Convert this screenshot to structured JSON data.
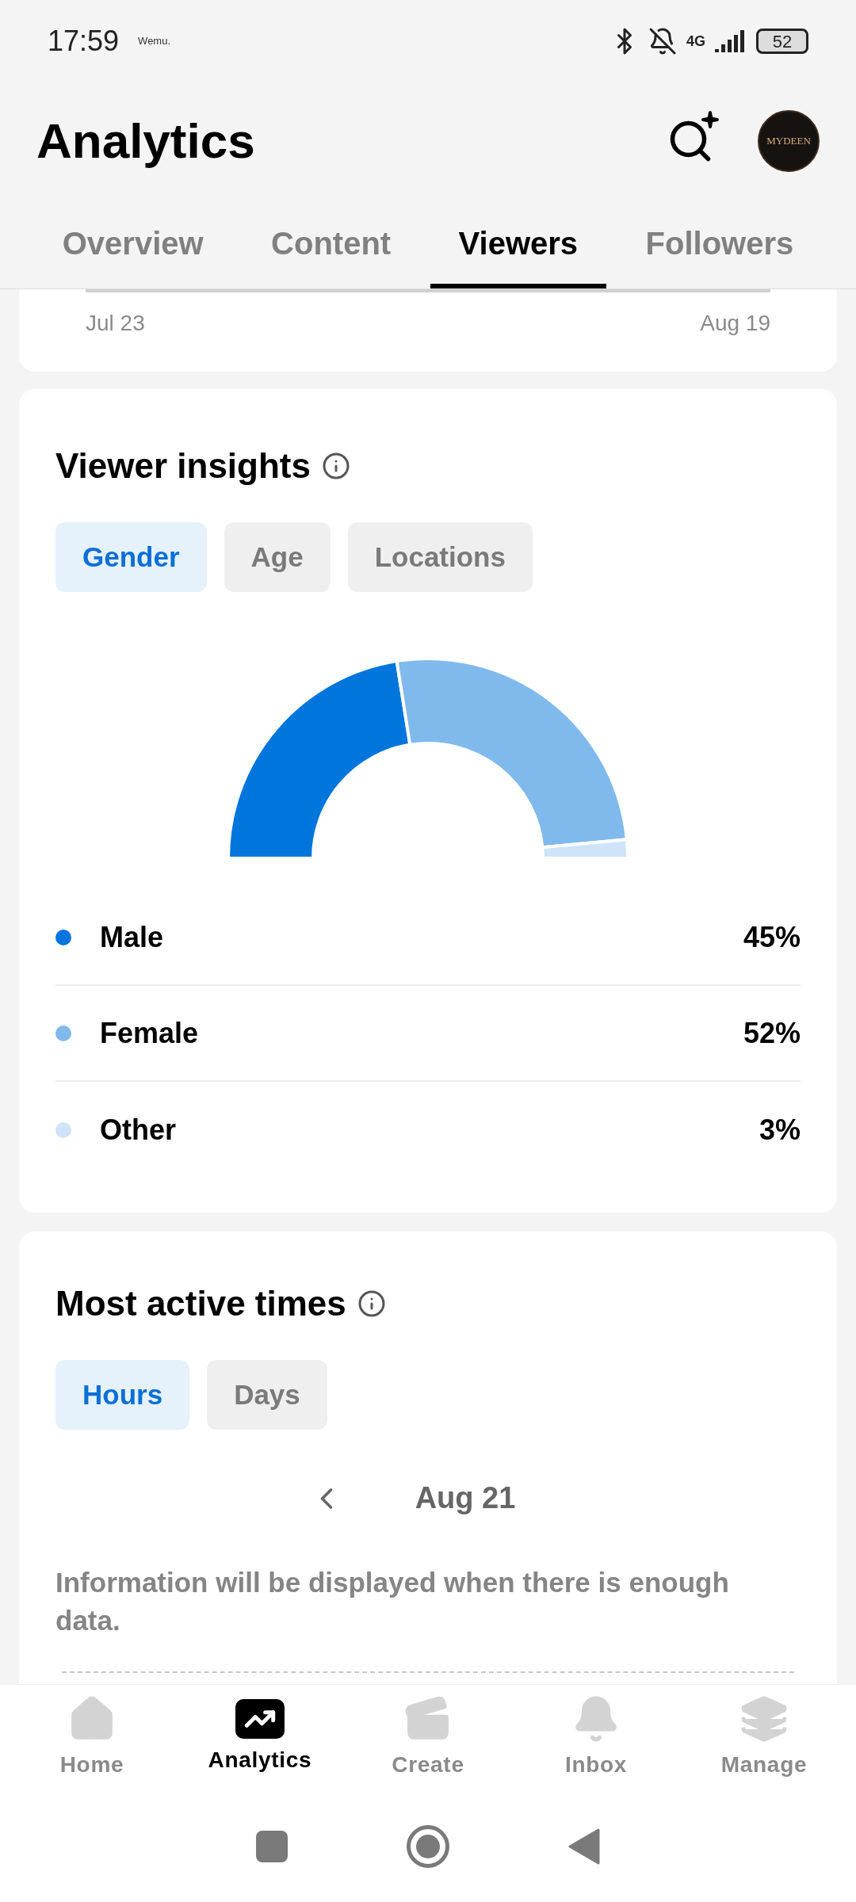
{
  "status_bar": {
    "time": "17:59",
    "carrier_logo": "Wemu.",
    "network": "4G",
    "battery": "52"
  },
  "header": {
    "title": "Analytics",
    "avatar_text": "MYDEEN"
  },
  "tabs": [
    {
      "label": "Overview",
      "selected": false
    },
    {
      "label": "Content",
      "selected": false
    },
    {
      "label": "Viewers",
      "selected": true
    },
    {
      "label": "Followers",
      "selected": false
    }
  ],
  "previous_card": {
    "start_date": "Jul 23",
    "end_date": "Aug 19"
  },
  "viewer_insights": {
    "title": "Viewer insights",
    "filters": [
      {
        "label": "Gender",
        "selected": true
      },
      {
        "label": "Age",
        "selected": false
      },
      {
        "label": "Locations",
        "selected": false
      }
    ],
    "chart_data": {
      "type": "donut",
      "categories": [
        "Male",
        "Female",
        "Other"
      ],
      "values": [
        45,
        52,
        3
      ]
    },
    "legend": [
      {
        "value": "45%",
        "color": "#0075dc"
      },
      {
        "value": "52%",
        "color": "#80baec"
      },
      {
        "value": "3%",
        "color": "#cfe4f8"
      }
    ]
  },
  "most_active_times": {
    "title": "Most active times",
    "filters": [
      {
        "label": "Hours",
        "selected": true
      },
      {
        "label": "Days",
        "selected": false
      }
    ],
    "date": "Aug 21",
    "message": "Information will be displayed when there is enough data."
  },
  "bottom_nav": [
    {
      "label": "Home",
      "kind": "home",
      "selected": false
    },
    {
      "label": "Analytics",
      "kind": "analytics",
      "selected": true
    },
    {
      "label": "Create",
      "kind": "create",
      "selected": false
    },
    {
      "label": "Inbox",
      "kind": "inbox",
      "selected": false
    },
    {
      "label": "Manage",
      "kind": "manage",
      "selected": false
    }
  ]
}
